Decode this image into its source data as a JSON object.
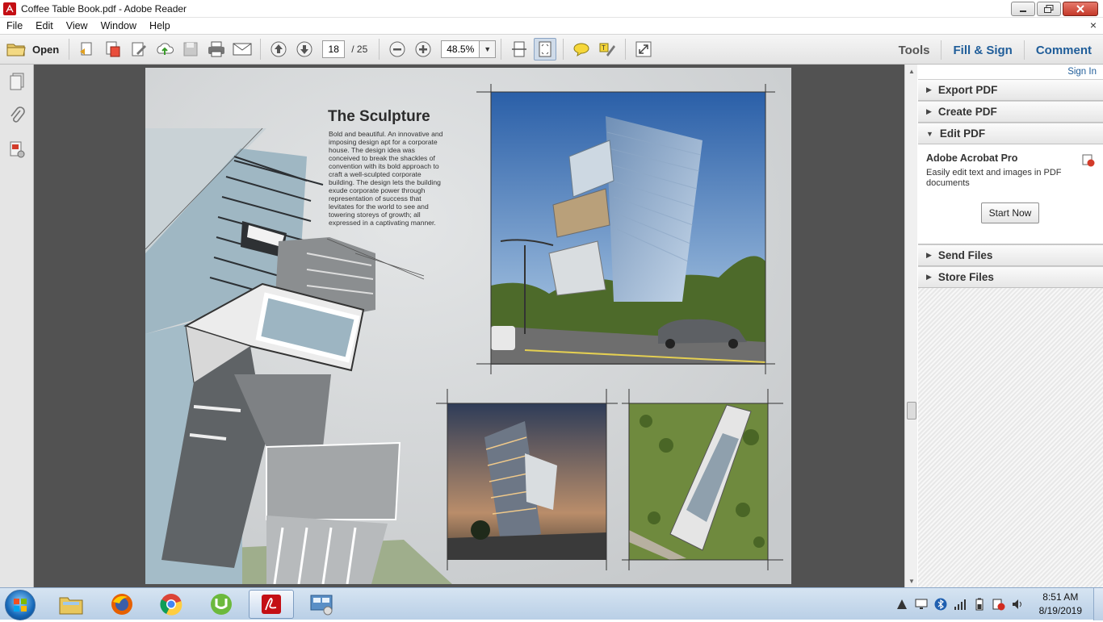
{
  "window": {
    "title": "Coffee Table Book.pdf - Adobe Reader",
    "app_icon": "adobe-reader-icon",
    "controls": [
      "minimize",
      "maximize",
      "close"
    ]
  },
  "menu": {
    "items": [
      "File",
      "Edit",
      "View",
      "Window",
      "Help"
    ],
    "close_glyph": "×"
  },
  "toolbar": {
    "open_label": "Open",
    "page_current": "18",
    "page_total": "/ 25",
    "zoom": "48.5%",
    "tools_label": "Tools",
    "fill_sign_label": "Fill & Sign",
    "comment_label": "Comment"
  },
  "right_pane": {
    "sign_in": "Sign In",
    "sections": {
      "export": "Export PDF",
      "create": "Create PDF",
      "edit": "Edit PDF",
      "send": "Send Files",
      "store": "Store Files"
    },
    "edit_body": {
      "product": "Adobe Acrobat Pro",
      "description": "Easily edit text and images in PDF documents",
      "button": "Start Now"
    }
  },
  "document": {
    "title": "The Sculpture",
    "body": "Bold and beautiful. An innovative and imposing design apt for a corporate house. The design idea was conceived to break the shackles of convention with its bold approach to craft a well-sculpted corporate building. The design lets the building exude corporate power through representation of success that levitates for the world to see and towering storeys of growth; all expressed in a captivating manner."
  },
  "taskbar": {
    "apps": [
      "file-explorer",
      "firefox",
      "chrome",
      "utorrent",
      "adobe-reader",
      "control-panel"
    ],
    "active_app": "adobe-reader",
    "time": "8:51 AM",
    "date": "8/19/2019"
  },
  "colors": {
    "accent_blue": "#1f5d99",
    "doc_background": "#525252",
    "adobe_red": "#c40f14"
  }
}
